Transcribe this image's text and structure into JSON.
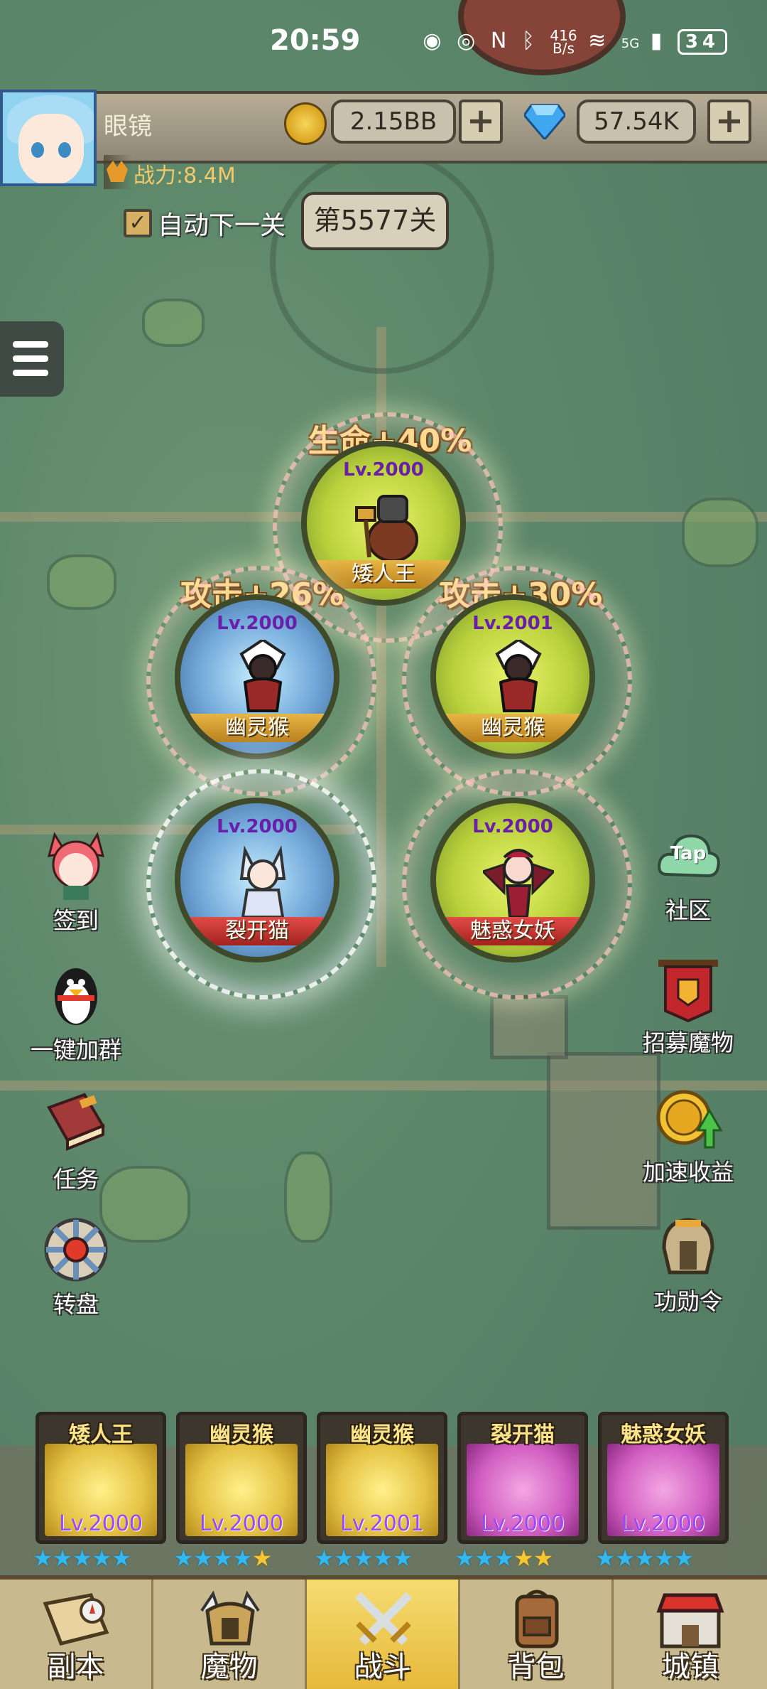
{
  "status_bar": {
    "time": "20:59",
    "net_speed_value": "416",
    "net_speed_unit": "B/s",
    "network": "5G",
    "battery": "34",
    "icons": [
      "notification-icon",
      "eye-icon",
      "nfc-icon",
      "bluetooth-icon",
      "wifi-icon",
      "signal-icon"
    ]
  },
  "player": {
    "name": "眼镜",
    "power": "战力:8.4M"
  },
  "resources": {
    "gold": "2.15BB",
    "gems": "57.54K",
    "plus": "+"
  },
  "stage": {
    "auto_next_label": "自动下一关",
    "auto_next_checked": true,
    "check_mark": "✓",
    "stage_label": "第5577关"
  },
  "formation": {
    "bonuses": [
      {
        "text": "生命+40%"
      },
      {
        "text": "攻击+26%"
      },
      {
        "text": "攻击+30%"
      }
    ],
    "slots": [
      {
        "name": "矮人王",
        "level": "Lv.2000",
        "theme": "gold"
      },
      {
        "name": "幽灵猴",
        "level": "Lv.2000",
        "theme": "blue"
      },
      {
        "name": "幽灵猴",
        "level": "Lv.2001",
        "theme": "gold"
      },
      {
        "name": "裂开猫",
        "level": "Lv.2000",
        "theme": "blue"
      },
      {
        "name": "魅惑女妖",
        "level": "Lv.2000",
        "theme": "gold"
      }
    ]
  },
  "left_menu": [
    {
      "label": "签到",
      "icon": "cat-girl-icon"
    },
    {
      "label": "一键加群",
      "icon": "penguin-icon"
    },
    {
      "label": "任务",
      "icon": "book-icon"
    },
    {
      "label": "转盘",
      "icon": "wheel-icon"
    }
  ],
  "right_menu": [
    {
      "label": "社区",
      "icon": "tap-cloud-icon",
      "badge": "Tap"
    },
    {
      "label": "招募魔物",
      "icon": "banner-icon"
    },
    {
      "label": "加速收益",
      "icon": "coin-boost-icon"
    },
    {
      "label": "功勋令",
      "icon": "helmet-icon"
    }
  ],
  "team": [
    {
      "name": "矮人王",
      "level": "Lv.2000",
      "stars": "★★★★★",
      "stars_yellow": "",
      "theme": "gold"
    },
    {
      "name": "幽灵猴",
      "level": "Lv.2000",
      "stars": "★★★★",
      "stars_yellow": "★",
      "theme": "gold"
    },
    {
      "name": "幽灵猴",
      "level": "Lv.2001",
      "stars": "★★★★★",
      "stars_yellow": "",
      "theme": "gold"
    },
    {
      "name": "裂开猫",
      "level": "Lv.2000",
      "stars": "★★★",
      "stars_yellow": "★★",
      "theme": "pink"
    },
    {
      "name": "魅惑女妖",
      "level": "Lv.2000",
      "stars": "★★★★★",
      "stars_yellow": "",
      "theme": "pink"
    }
  ],
  "bottom_nav": [
    {
      "label": "副本",
      "icon": "map-scroll-icon",
      "active": false
    },
    {
      "label": "魔物",
      "icon": "monster-helmet-icon",
      "active": false
    },
    {
      "label": "战斗",
      "icon": "crossed-swords-icon",
      "active": true
    },
    {
      "label": "背包",
      "icon": "backpack-icon",
      "active": false
    },
    {
      "label": "城镇",
      "icon": "town-shop-icon",
      "active": false
    }
  ],
  "colors": {
    "map_green": "#5f8a6e",
    "gold_text": "#fcd98c",
    "level_purple": "#6a1fa8",
    "active_tab": "#f5dc72",
    "star_blue": "#32b7ee",
    "star_yellow": "#f7c531"
  }
}
